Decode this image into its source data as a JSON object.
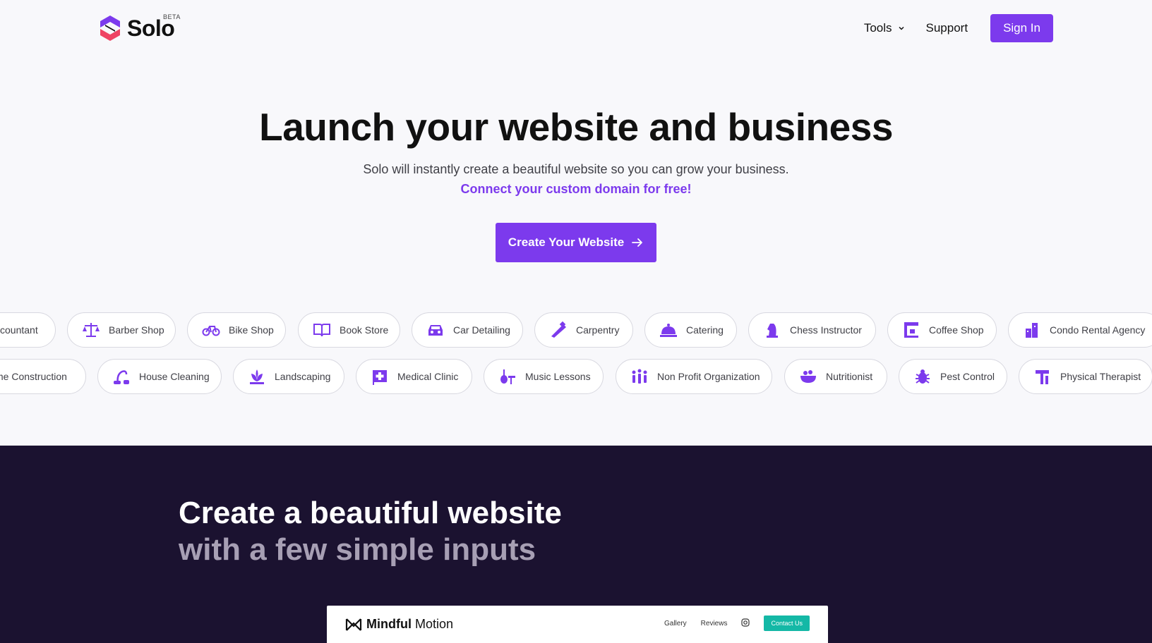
{
  "header": {
    "logo_text": "Solo",
    "beta": "BETA",
    "nav": {
      "tools": "Tools",
      "support": "Support",
      "sign_in": "Sign In"
    }
  },
  "hero": {
    "title": "Launch your website and business",
    "subtitle": "Solo will instantly create a beautiful website so you can grow your business.",
    "link": "Connect your custom domain for free!",
    "cta": "Create Your Website"
  },
  "categories": {
    "row1": [
      "ccountant",
      "Barber Shop",
      "Bike Shop",
      "Book Store",
      "Car Detailing",
      "Carpentry",
      "Catering",
      "Chess Instructor",
      "Coffee Shop",
      "Condo Rental Agency"
    ],
    "row2": [
      "me Construction",
      "House Cleaning",
      "Landscaping",
      "Medical Clinic",
      "Music Lessons",
      "Non Profit Organization",
      "Nutritionist",
      "Pest Control",
      "Physical Therapist"
    ]
  },
  "section2": {
    "title_line1": "Create a beautiful website",
    "title_line2": "with a few simple inputs"
  },
  "preview": {
    "brand_bold": "Mindful",
    "brand_light": "Motion",
    "nav": [
      "Gallery",
      "Reviews"
    ],
    "contact": "Contact Us"
  },
  "colors": {
    "accent": "#7c3aed",
    "dark_bg": "#1b1230",
    "teal": "#14b8a6"
  }
}
